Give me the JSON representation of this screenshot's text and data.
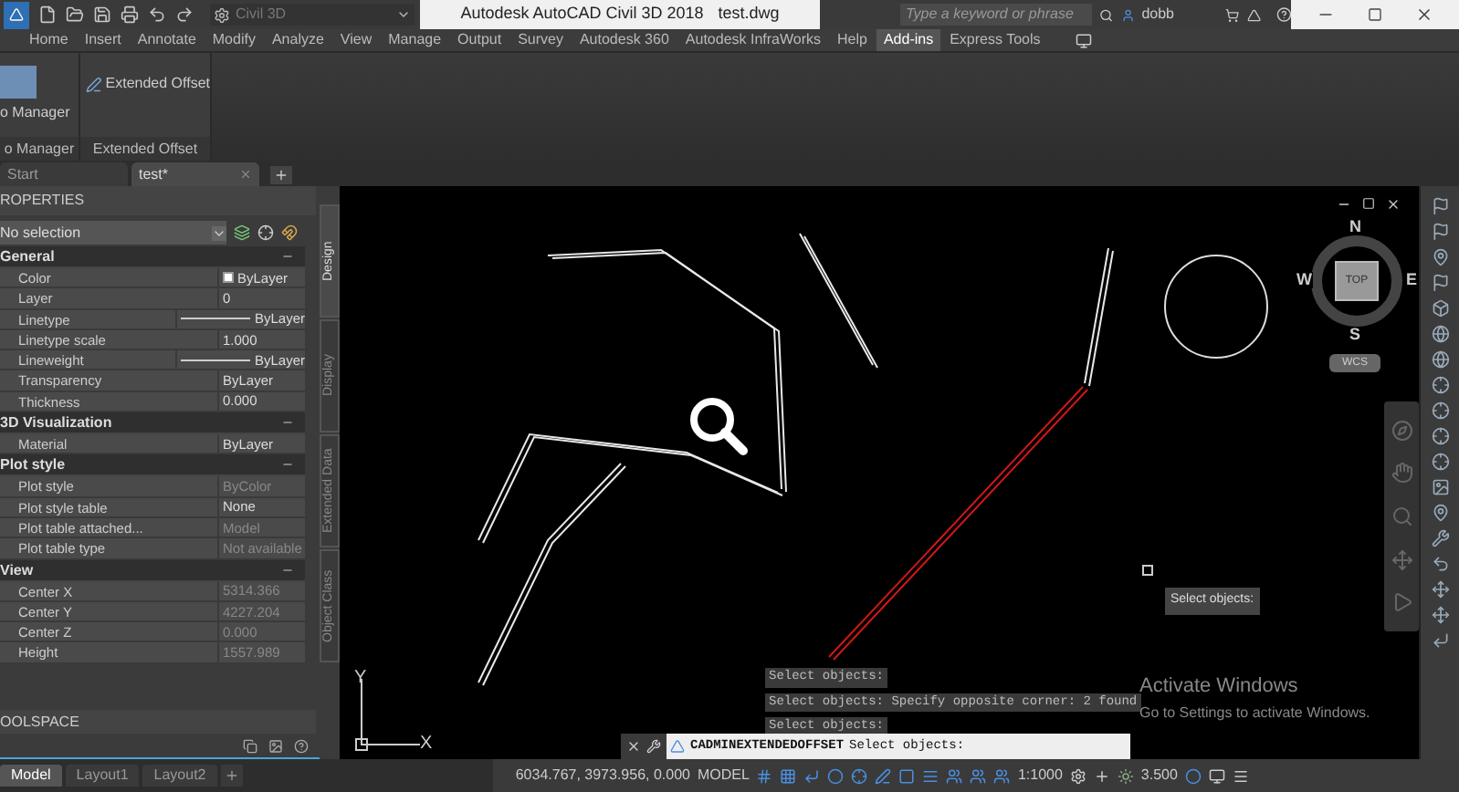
{
  "quick_access": {
    "workspace": "Civil 3D"
  },
  "title": "Autodesk AutoCAD Civil 3D 2018",
  "filename": "test.dwg",
  "search": {
    "placeholder": "Type a keyword or phrase"
  },
  "user": "dobb",
  "ribbon_tabs": [
    {
      "label": "Home",
      "selected": false
    },
    {
      "label": "Insert",
      "selected": false
    },
    {
      "label": "Annotate",
      "selected": false
    },
    {
      "label": "Modify",
      "selected": false
    },
    {
      "label": "Analyze",
      "selected": false
    },
    {
      "label": "View",
      "selected": false
    },
    {
      "label": "Manage",
      "selected": false
    },
    {
      "label": "Output",
      "selected": false
    },
    {
      "label": "Survey",
      "selected": false
    },
    {
      "label": "Autodesk 360",
      "selected": false
    },
    {
      "label": "Autodesk InfraWorks",
      "selected": false
    },
    {
      "label": "Help",
      "selected": false
    },
    {
      "label": "Add-ins",
      "selected": true
    },
    {
      "label": "Express Tools",
      "selected": false
    }
  ],
  "ribbon_panels": [
    {
      "kind": "large",
      "button": "o Manager",
      "title": "o Manager"
    },
    {
      "kind": "small",
      "button": "Extended Offset",
      "title": "Extended Offset"
    }
  ],
  "file_tabs": [
    {
      "label": "Start",
      "selected": false
    },
    {
      "label": "test*",
      "selected": true
    }
  ],
  "properties": {
    "title": "ROPERTIES",
    "selection": "No selection",
    "sections": [
      {
        "title": "General",
        "rows": [
          {
            "name": "Color",
            "value": "ByLayer",
            "kind": "swatch",
            "disabled": false
          },
          {
            "name": "Layer",
            "value": "0",
            "kind": "text",
            "disabled": false
          },
          {
            "name": "Linetype",
            "value": "ByLayer",
            "kind": "line",
            "disabled": false
          },
          {
            "name": "Linetype scale",
            "value": "1.000",
            "kind": "text",
            "disabled": false
          },
          {
            "name": "Lineweight",
            "value": "ByLayer",
            "kind": "line",
            "disabled": false
          },
          {
            "name": "Transparency",
            "value": "ByLayer",
            "kind": "text",
            "disabled": false
          },
          {
            "name": "Thickness",
            "value": "0.000",
            "kind": "text",
            "disabled": false
          }
        ]
      },
      {
        "title": "3D Visualization",
        "rows": [
          {
            "name": "Material",
            "value": "ByLayer",
            "kind": "text",
            "disabled": false
          }
        ]
      },
      {
        "title": "Plot style",
        "rows": [
          {
            "name": "Plot style",
            "value": "ByColor",
            "kind": "text",
            "disabled": true
          },
          {
            "name": "Plot style table",
            "value": "None",
            "kind": "text",
            "disabled": false
          },
          {
            "name": "Plot table attached...",
            "value": "Model",
            "kind": "text",
            "disabled": true
          },
          {
            "name": "Plot table type",
            "value": "Not available",
            "kind": "text",
            "disabled": true
          }
        ]
      },
      {
        "title": "View",
        "rows": [
          {
            "name": "Center X",
            "value": "5314.366",
            "kind": "text",
            "disabled": true
          },
          {
            "name": "Center Y",
            "value": "4227.204",
            "kind": "text",
            "disabled": true
          },
          {
            "name": "Center Z",
            "value": "0.000",
            "kind": "text",
            "disabled": true
          },
          {
            "name": "Height",
            "value": "1557.989",
            "kind": "text",
            "disabled": true
          }
        ]
      }
    ]
  },
  "side_tabs": [
    {
      "label": "Design",
      "selected": true
    },
    {
      "label": "Display",
      "selected": false
    },
    {
      "label": "Extended Data",
      "selected": false
    },
    {
      "label": "Object Class",
      "selected": false
    }
  ],
  "toolspace": "OOLSPACE",
  "layout_tabs": [
    {
      "label": "Model",
      "selected": true
    },
    {
      "label": "Layout1",
      "selected": false
    },
    {
      "label": "Layout2",
      "selected": false
    }
  ],
  "viewcube": {
    "north": "N",
    "south": "S",
    "east": "E",
    "west": "W",
    "face": "TOP",
    "ucs": "WCS"
  },
  "ucs_icon": {
    "x": "X",
    "y": "Y"
  },
  "tooltip": "Select objects:",
  "command_history": [
    "Select objects:",
    "Select objects: Specify opposite corner: 2 found",
    "Select objects:"
  ],
  "command_line": {
    "command": "CADMINEXTENDEDOFFSET",
    "prompt": "Select objects:"
  },
  "activation_notice": {
    "title": "Activate Windows",
    "body": "Go to Settings to activate Windows."
  },
  "status_bar": {
    "coordinates": "6034.767, 3973.956, 0.000",
    "space": "MODEL",
    "scale": "1:1000",
    "value": "3.500"
  }
}
